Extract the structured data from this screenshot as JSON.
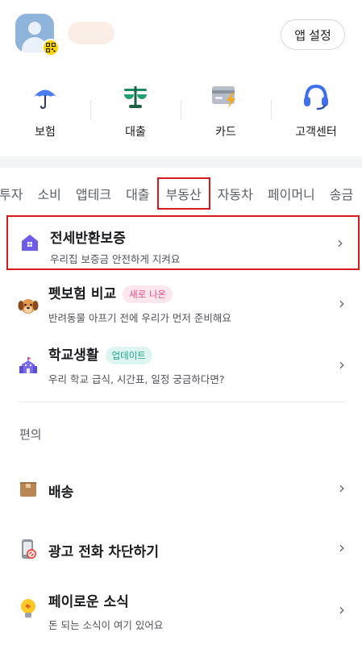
{
  "header": {
    "settings_label": "앱 설정"
  },
  "quick_menu": [
    {
      "label": "보험",
      "icon": "umbrella-icon"
    },
    {
      "label": "대출",
      "icon": "scale-icon"
    },
    {
      "label": "카드",
      "icon": "card-icon"
    },
    {
      "label": "고객센터",
      "icon": "headset-icon"
    }
  ],
  "tabs": [
    "투자",
    "소비",
    "앱테크",
    "대출",
    "부동산",
    "자동차",
    "페이머니",
    "송금"
  ],
  "active_tab": "부동산",
  "rows": [
    {
      "title": "전세반환보증",
      "subtitle": "우리집 보증금 안전하게 지켜요",
      "icon": "house-icon"
    },
    {
      "title": "펫보험 비교",
      "badge": "새로 나온",
      "subtitle": "반려동물 아프기 전에 우리가 먼저 준비해요",
      "icon": "dog-icon"
    },
    {
      "title": "학교생활",
      "badge": "업데이트",
      "subtitle": "우리 학교 급식, 시간표, 일정 궁금하다면?",
      "icon": "school-icon"
    }
  ],
  "section": {
    "title": "편의"
  },
  "convenience": [
    {
      "title": "배송",
      "icon": "box-icon"
    },
    {
      "title": "광고 전화 차단하기",
      "icon": "phone-block-icon"
    },
    {
      "title": "페이로운 소식",
      "subtitle": "돈 되는 소식이 여기 있어요",
      "icon": "bulb-icon"
    }
  ],
  "colors": {
    "highlight": "#d71920",
    "new_badge": "#e84a84",
    "update_badge": "#17a88a"
  }
}
